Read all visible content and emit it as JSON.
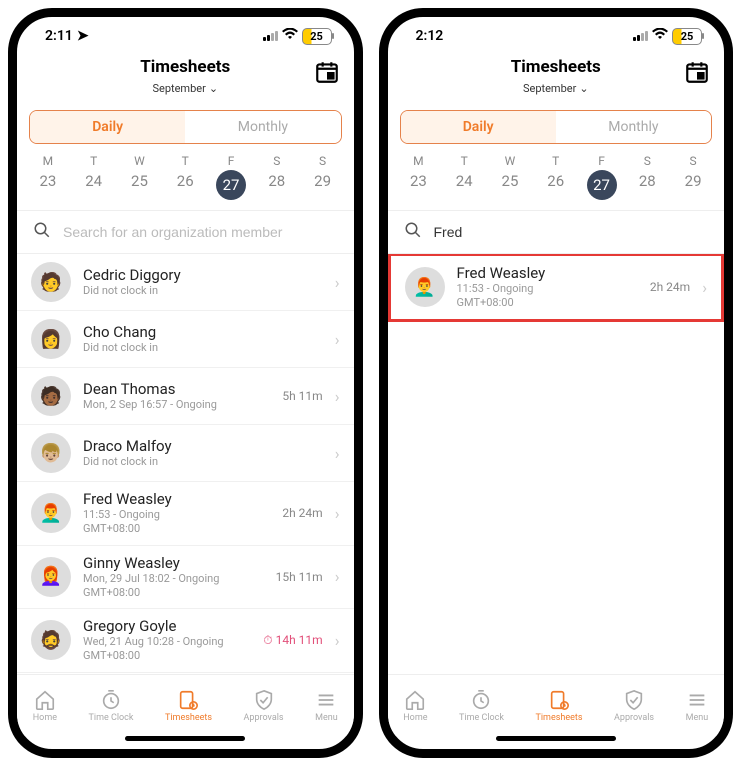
{
  "screens": [
    {
      "status": {
        "time": "2:11",
        "nav_arrow": true,
        "battery": "25"
      },
      "header": {
        "title": "Timesheets",
        "month": "September"
      },
      "seg": {
        "daily": "Daily",
        "monthly": "Monthly",
        "active": "daily"
      },
      "week": [
        {
          "lab": "M",
          "num": "23"
        },
        {
          "lab": "T",
          "num": "24"
        },
        {
          "lab": "W",
          "num": "25"
        },
        {
          "lab": "T",
          "num": "26"
        },
        {
          "lab": "F",
          "num": "27",
          "selected": true
        },
        {
          "lab": "S",
          "num": "28"
        },
        {
          "lab": "S",
          "num": "29"
        }
      ],
      "search": {
        "placeholder": "Search for an organization member",
        "value": ""
      },
      "rows": [
        {
          "name": "Cedric Diggory",
          "sub1": "Did not clock in",
          "sub2": "",
          "right": "",
          "avatar": "🧑"
        },
        {
          "name": "Cho Chang",
          "sub1": "Did not clock in",
          "sub2": "",
          "right": "",
          "avatar": "👩"
        },
        {
          "name": "Dean Thomas",
          "sub1": "Mon, 2 Sep 16:57 - Ongoing",
          "sub2": "",
          "right": "5h 11m",
          "avatar": "🧑🏾"
        },
        {
          "name": "Draco Malfoy",
          "sub1": "Did not clock in",
          "sub2": "",
          "right": "",
          "avatar": "👦🏼"
        },
        {
          "name": "Fred Weasley",
          "sub1": "11:53 - Ongoing",
          "sub2": "GMT+08:00",
          "right": "2h 24m",
          "avatar": "👨‍🦰"
        },
        {
          "name": "Ginny Weasley",
          "sub1": "Mon, 29 Jul 18:02 - Ongoing",
          "sub2": "GMT+08:00",
          "right": "15h 11m",
          "avatar": "👩‍🦰"
        },
        {
          "name": "Gregory Goyle",
          "sub1": "Wed, 21 Aug 10:28 - Ongoing",
          "sub2": "GMT+08:00",
          "right": "14h 11m",
          "avatar": "🧔",
          "alert": true,
          "alert_icon": "⏱"
        }
      ]
    },
    {
      "status": {
        "time": "2:12",
        "nav_arrow": false,
        "battery": "25"
      },
      "header": {
        "title": "Timesheets",
        "month": "September"
      },
      "seg": {
        "daily": "Daily",
        "monthly": "Monthly",
        "active": "daily"
      },
      "week": [
        {
          "lab": "M",
          "num": "23"
        },
        {
          "lab": "T",
          "num": "24"
        },
        {
          "lab": "W",
          "num": "25"
        },
        {
          "lab": "T",
          "num": "26"
        },
        {
          "lab": "F",
          "num": "27",
          "selected": true
        },
        {
          "lab": "S",
          "num": "28"
        },
        {
          "lab": "S",
          "num": "29"
        }
      ],
      "search": {
        "placeholder": "",
        "value": "Fred"
      },
      "rows": [
        {
          "name": "Fred Weasley",
          "sub1": "11:53 - Ongoing",
          "sub2": "GMT+08:00",
          "right": "2h 24m",
          "avatar": "👨‍🦰",
          "highlight": true
        }
      ]
    }
  ],
  "tabs": {
    "home": "Home",
    "timeclock": "Time Clock",
    "timesheets": "Timesheets",
    "approvals": "Approvals",
    "menu": "Menu",
    "active": "timesheets"
  }
}
